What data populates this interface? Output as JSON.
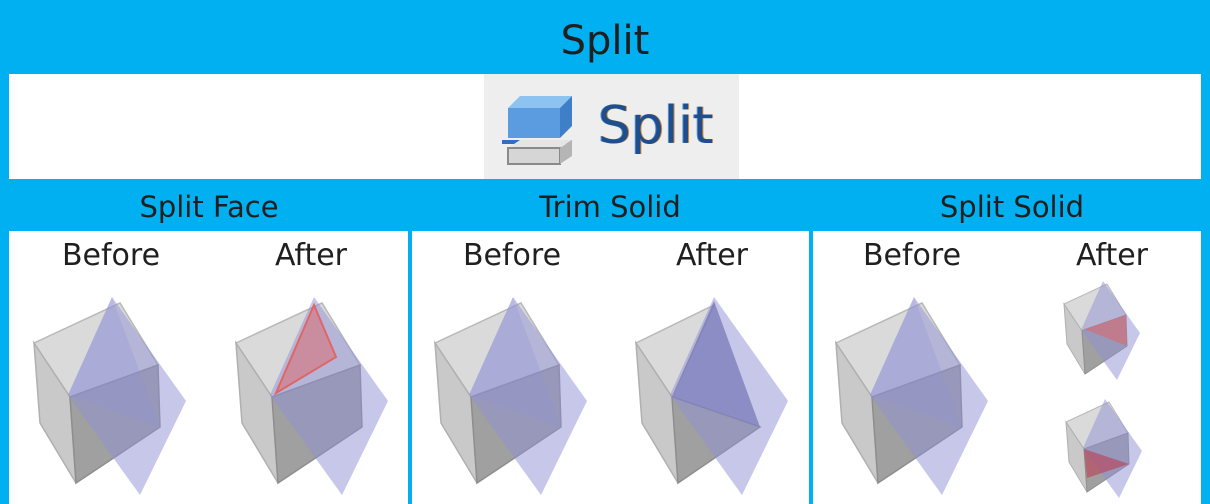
{
  "header": {
    "title": "Split"
  },
  "tool": {
    "label": "Split",
    "icon": "split-tool-icon"
  },
  "sections": [
    {
      "title": "Split Face",
      "before": "Before",
      "after": "After"
    },
    {
      "title": "Trim Solid",
      "before": "Before",
      "after": "After"
    },
    {
      "title": "Split Solid",
      "before": "Before",
      "after": "After"
    }
  ],
  "colors": {
    "accent": "#00b0f0",
    "plane": "#8f8fd6",
    "cube": "#d9d9d9",
    "highlight": "#e06666"
  }
}
